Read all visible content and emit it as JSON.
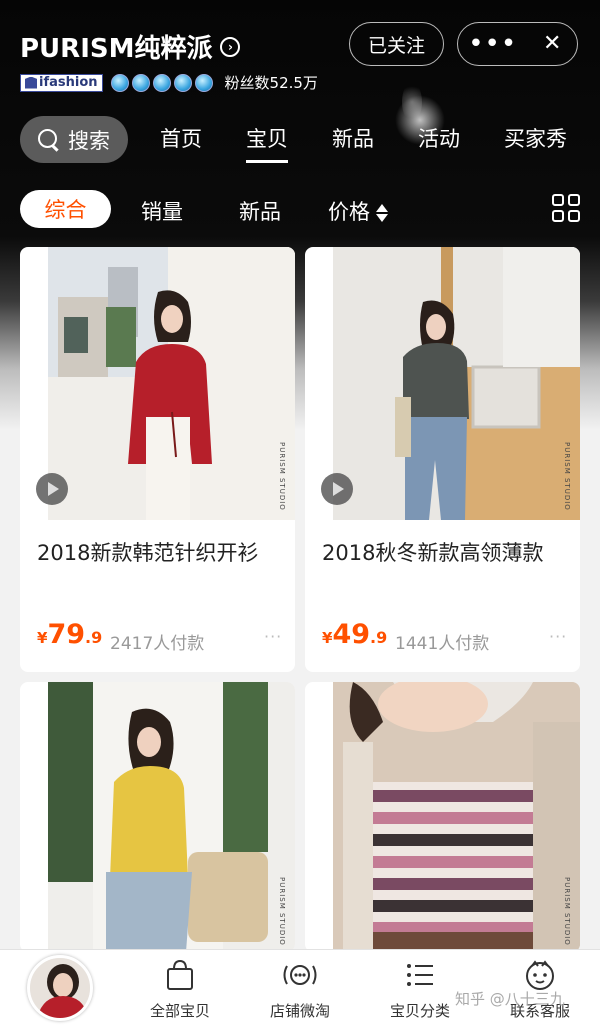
{
  "header": {
    "shop_name": "PURISM纯粹派",
    "follow_label": "已关注",
    "menu_dots": "•••",
    "close_label": "✕",
    "badge": "ifashion",
    "fans_text": "粉丝数52.5万",
    "diamond_count": 5
  },
  "nav": {
    "search_label": "搜索",
    "tabs": [
      "首页",
      "宝贝",
      "新品",
      "活动",
      "买家秀"
    ],
    "active_tab": "宝贝"
  },
  "filters": {
    "items": [
      "综合",
      "销量",
      "新品",
      "价格"
    ],
    "active": "综合"
  },
  "products": [
    {
      "title": "2018新款韩范针织开衫",
      "currency": "¥",
      "price_int": "79",
      "price_dec": ".9",
      "sold": "2417人付款",
      "more": "···",
      "studio": "PURISM STUDIO"
    },
    {
      "title": "2018秋冬新款高领薄款",
      "currency": "¥",
      "price_int": "49",
      "price_dec": ".9",
      "sold": "1441人付款",
      "more": "···",
      "studio": "PURISM STUDIO"
    },
    {
      "studio": "PURISM STUDIO"
    },
    {
      "studio": "PURISM STUDIO"
    }
  ],
  "bottom_bar": {
    "items": [
      "全部宝贝",
      "店铺微淘",
      "宝贝分类",
      "联系客服"
    ]
  },
  "watermark": "知乎 @八十三九",
  "colors": {
    "accent": "#ff5000",
    "header_bg": "#0b0b0b"
  }
}
